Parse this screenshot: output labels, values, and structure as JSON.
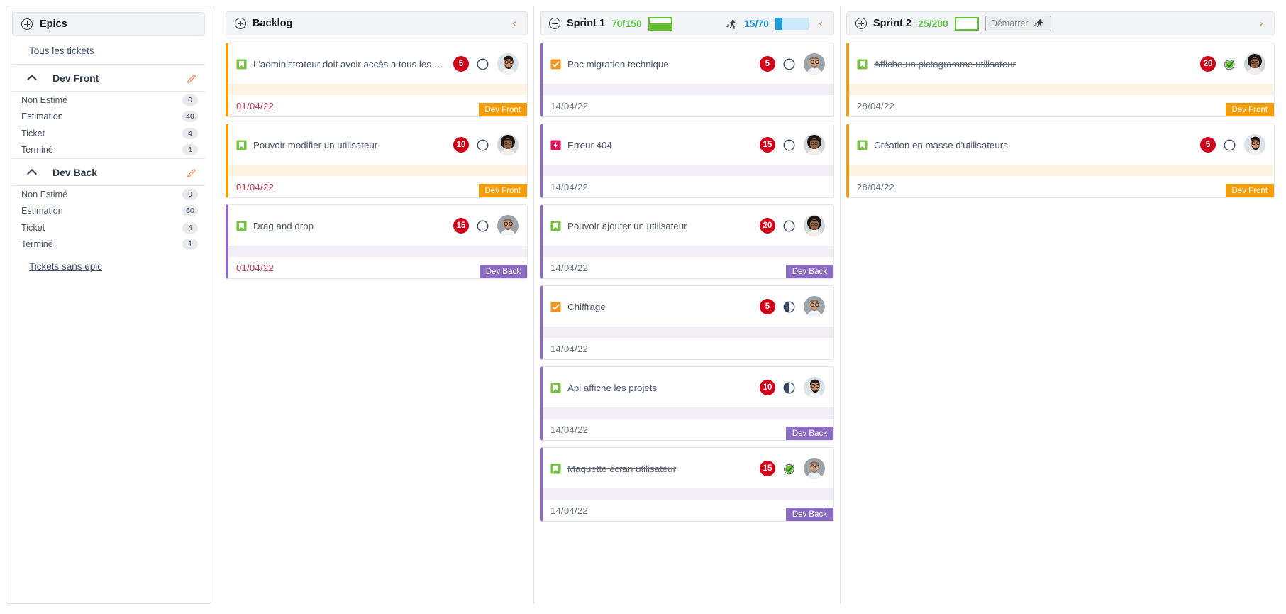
{
  "colors": {
    "accent_orange": "#f59e0b",
    "accent_purple": "#8b6cc1",
    "points_badge": "#d0021b",
    "green": "#62c12c",
    "blue": "#1e9bdd",
    "date_red": "#b8344a"
  },
  "sidebar": {
    "header": {
      "label": "Epics",
      "icon": "circle-plus-icon"
    },
    "all_tickets_link": "Tous les tickets",
    "no_epic_link": "Tickets sans epic",
    "stat_labels": [
      "Non Estimé",
      "Estimation",
      "Ticket",
      "Terminé"
    ],
    "epics": [
      {
        "name": "Dev Front",
        "collapse_icon": "chevron-up-icon",
        "edit_icon": "pencil-icon",
        "stats": [
          {
            "label": "Non Estimé",
            "value": "0"
          },
          {
            "label": "Estimation",
            "value": "40"
          },
          {
            "label": "Ticket",
            "value": "4"
          },
          {
            "label": "Terminé",
            "value": "1"
          }
        ]
      },
      {
        "name": "Dev Back",
        "collapse_icon": "chevron-up-icon",
        "edit_icon": "pencil-icon",
        "stats": [
          {
            "label": "Non Estimé",
            "value": "0"
          },
          {
            "label": "Estimation",
            "value": "60"
          },
          {
            "label": "Ticket",
            "value": "4"
          },
          {
            "label": "Terminé",
            "value": "1"
          }
        ]
      }
    ]
  },
  "columns": [
    {
      "id": "backlog",
      "title": "Backlog",
      "add_icon": "circle-plus-icon",
      "collapse_icon": "chevron-left-icon",
      "collapse_glyph": "‹",
      "cards": [
        {
          "type_icon": "bookmark-icon",
          "type": "story",
          "title": "L'administrateur doit avoir accès a tous les écrans",
          "points": "5",
          "status": "todo",
          "status_icon": "circle-outline-icon",
          "avatar": "avatar-man-glasses-beard",
          "date": "01/04/22",
          "epic_tag": "Dev Front",
          "epic_color": "orange",
          "done": false
        },
        {
          "type_icon": "bookmark-icon",
          "type": "story",
          "title": "Pouvoir modifier un utilisateur",
          "points": "10",
          "status": "todo",
          "status_icon": "circle-outline-icon",
          "avatar": "avatar-woman-curly",
          "date": "01/04/22",
          "epic_tag": "Dev Front",
          "epic_color": "orange",
          "done": false
        },
        {
          "type_icon": "bookmark-icon",
          "type": "story",
          "title": "Drag and drop",
          "points": "15",
          "status": "todo",
          "status_icon": "circle-outline-icon",
          "avatar": "avatar-man-bald-glasses",
          "date": "01/04/22",
          "epic_tag": "Dev Back",
          "epic_color": "purple",
          "done": false
        }
      ]
    },
    {
      "id": "sprint1",
      "title": "Sprint 1",
      "add_icon": "circle-plus-icon",
      "points_total": "70/150",
      "points_total_color": "green",
      "vbar_fill_percent": 47,
      "running_icon": "runner-icon",
      "points_done": "15/70",
      "points_done_color": "blue",
      "hbar_fill_percent": 21,
      "collapse_icon": "chevron-left-icon",
      "collapse_glyph": "‹",
      "cards": [
        {
          "type_icon": "checkbox-orange-icon",
          "type": "task",
          "title": "Poc migration technique",
          "points": "5",
          "status": "todo",
          "status_icon": "circle-outline-icon",
          "avatar": "avatar-man-bald-glasses",
          "date": "14/04/22",
          "epic_tag": "",
          "epic_color": "purple",
          "done": false
        },
        {
          "type_icon": "bug-bolt-icon",
          "type": "bug",
          "title": "Erreur 404",
          "points": "15",
          "status": "todo",
          "status_icon": "circle-outline-icon",
          "avatar": "avatar-woman-curly",
          "date": "14/04/22",
          "epic_tag": "",
          "epic_color": "purple",
          "done": false
        },
        {
          "type_icon": "bookmark-icon",
          "type": "story",
          "title": "Pouvoir ajouter un utilisateur",
          "points": "20",
          "status": "todo",
          "status_icon": "circle-outline-icon",
          "avatar": "avatar-woman-curly",
          "date": "14/04/22",
          "epic_tag": "Dev Back",
          "epic_color": "purple",
          "done": false
        },
        {
          "type_icon": "checkbox-orange-icon",
          "type": "task",
          "title": "Chiffrage",
          "points": "5",
          "status": "in-progress",
          "status_icon": "half-circle-icon",
          "avatar": "avatar-man-bald-glasses",
          "date": "14/04/22",
          "epic_tag": "",
          "epic_color": "purple",
          "done": false
        },
        {
          "type_icon": "bookmark-icon",
          "type": "story",
          "title": "Api affiche les projets",
          "points": "10",
          "status": "in-progress",
          "status_icon": "half-circle-icon",
          "avatar": "avatar-man-glasses-beard",
          "date": "14/04/22",
          "epic_tag": "Dev Back",
          "epic_color": "purple",
          "done": false
        },
        {
          "type_icon": "bookmark-icon",
          "type": "story",
          "title": "Maquette écran utilisateur",
          "points": "15",
          "status": "done",
          "status_icon": "check-circle-green-icon",
          "avatar": "avatar-man-bald-glasses",
          "date": "14/04/22",
          "epic_tag": "Dev Back",
          "epic_color": "purple",
          "done": true
        }
      ]
    },
    {
      "id": "sprint2",
      "title": "Sprint 2",
      "add_icon": "circle-plus-icon",
      "points_total": "25/200",
      "points_total_color": "green",
      "vbar_fill_percent": 0,
      "start_button_label": "Démarrer",
      "start_button_icon": "runner-icon",
      "collapse_icon": "chevron-right-icon",
      "collapse_glyph": "›",
      "cards": [
        {
          "type_icon": "bookmark-icon",
          "type": "story",
          "title": "Affiche un pictogramme utilisateur",
          "points": "20",
          "status": "done",
          "status_icon": "check-circle-green-icon",
          "avatar": "avatar-woman-curly",
          "date": "28/04/22",
          "epic_tag": "Dev Front",
          "epic_color": "orange",
          "done": true
        },
        {
          "type_icon": "bookmark-icon",
          "type": "story",
          "title": "Création en masse d'utilisateurs",
          "points": "5",
          "status": "todo",
          "status_icon": "circle-outline-icon",
          "avatar": "avatar-man-glasses-beard",
          "date": "28/04/22",
          "epic_tag": "Dev Front",
          "epic_color": "orange",
          "done": false
        }
      ]
    }
  ]
}
